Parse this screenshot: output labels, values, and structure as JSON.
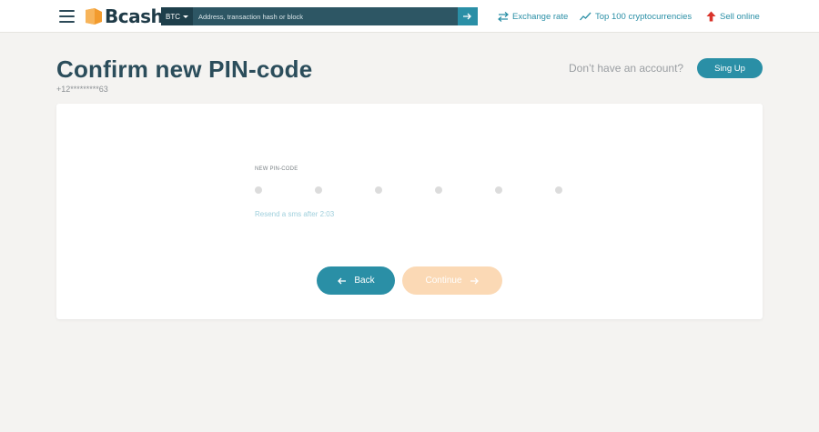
{
  "header": {
    "logo_text": "Bcash",
    "search": {
      "currency": "BTC",
      "placeholder": "Address, transaction hash or block"
    },
    "nav": {
      "exchange_rate": "Exchange rate",
      "top100": "Top 100 cryptocurrencies",
      "sell_online": "Sell online"
    }
  },
  "page": {
    "title": "Confirm new PIN-code",
    "phone": "+12*********63",
    "no_account_text": "Don’t have an account?",
    "signup_label": "Sing Up"
  },
  "form": {
    "pin_label": "NEW PIN-CODE",
    "pin_length": 6,
    "resend_text": "Resend a sms after 2:03",
    "back_label": "Back",
    "continue_label": "Continue"
  },
  "colors": {
    "accent": "#2a8fa6",
    "dark_teal": "#2d5664",
    "title": "#2b4d5b",
    "logo_orange": "#f29b2e",
    "continue_disabled": "#fbd9b5",
    "sell_arrow": "#d9342b",
    "background": "#f4f3f1"
  },
  "icons": {
    "menu": "hamburger-icon",
    "search_go": "arrow-right-icon",
    "exchange": "exchange-arrows-icon",
    "top100": "trend-line-icon",
    "sell": "arrow-up-icon",
    "back": "arrow-left-icon",
    "continue": "arrow-right-icon"
  }
}
